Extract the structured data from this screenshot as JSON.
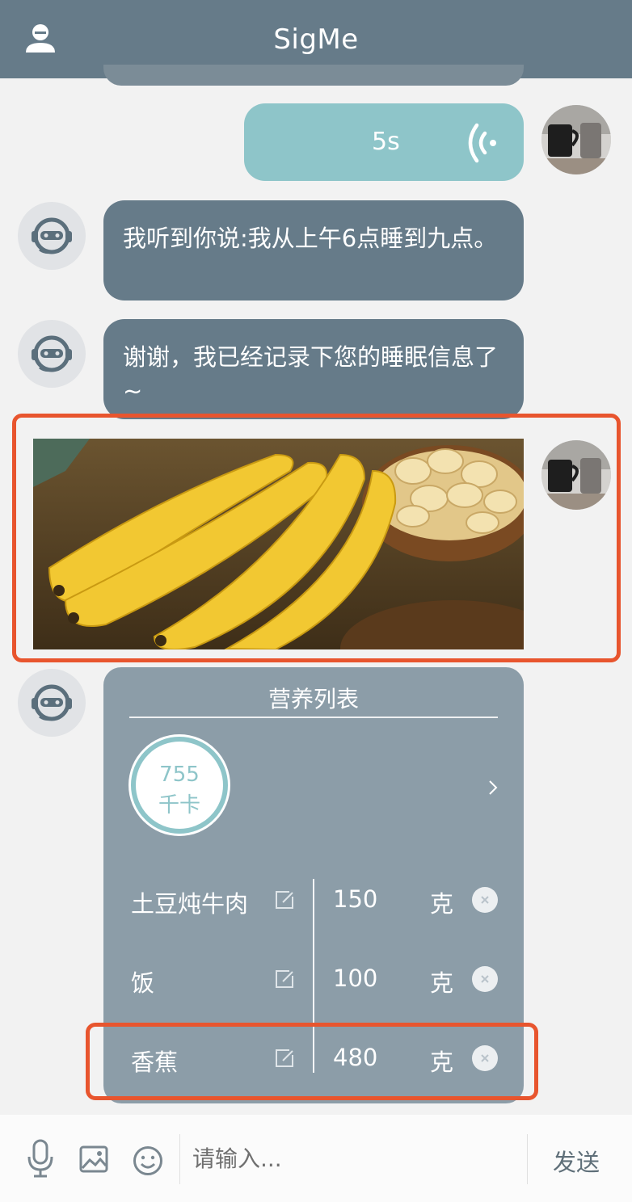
{
  "header": {
    "title": "SigMe",
    "user_icon": "user-icon"
  },
  "messages": {
    "voice": {
      "duration": "5s",
      "icon": "voice-wave-icon"
    },
    "bot1": {
      "text": "我听到你说:我从上午6点睡到九点。"
    },
    "bot2": {
      "text": "谢谢，我已经记录下您的睡眠信息了~"
    },
    "image": {
      "subject": "bananas"
    }
  },
  "nutrition_card": {
    "title": "营养列表",
    "calories": {
      "value": "755",
      "unit": "千卡"
    },
    "items": [
      {
        "name": "土豆炖牛肉",
        "qty": "150",
        "unit": "克"
      },
      {
        "name": "饭",
        "qty": "100",
        "unit": "克"
      },
      {
        "name": "香蕉",
        "qty": "480",
        "unit": "克"
      }
    ]
  },
  "input_bar": {
    "placeholder": "请输入...",
    "send_label": "发送",
    "icons": [
      "microphone-icon",
      "image-icon",
      "emoji-icon"
    ]
  },
  "colors": {
    "header": "#667b89",
    "bot_bubble": "#667b89",
    "voice_bubble": "#8ec5c9",
    "card": "#8c9da8",
    "highlight": "#e8552e"
  }
}
